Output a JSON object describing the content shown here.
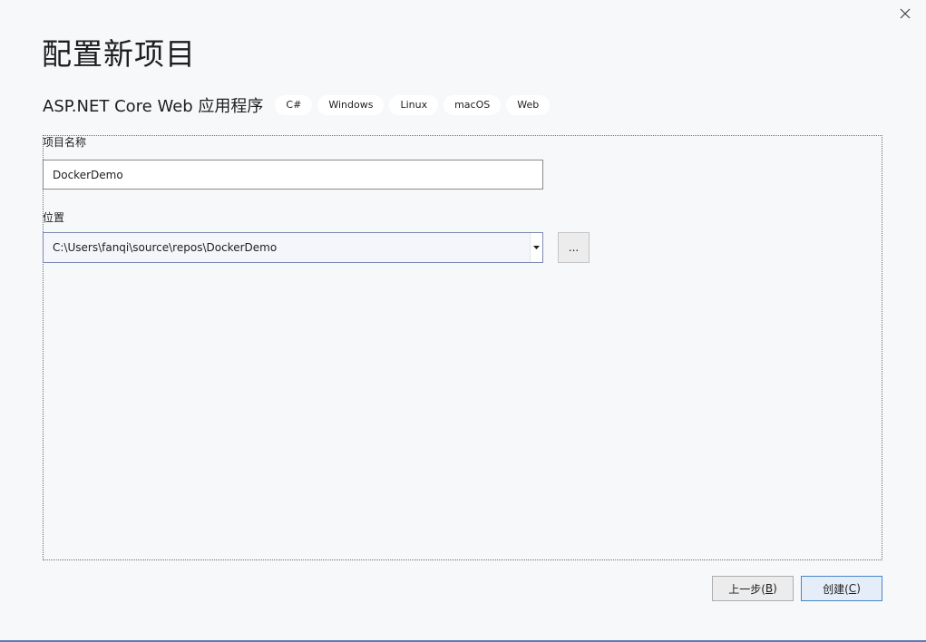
{
  "dialog": {
    "title": "配置新项目",
    "close_icon": "close-icon"
  },
  "template": {
    "name": "ASP.NET Core Web 应用程序",
    "tags": [
      "C#",
      "Windows",
      "Linux",
      "macOS",
      "Web"
    ]
  },
  "form": {
    "project_name_label": "项目名称",
    "project_name_value": "DockerDemo",
    "location_label": "位置",
    "location_value": "C:\\Users\\fanqi\\source\\repos\\DockerDemo",
    "browse_label": "..."
  },
  "buttons": {
    "back_label": "上一步(",
    "back_key": "B",
    "back_suffix": ")",
    "create_label": "创建(",
    "create_key": "C",
    "create_suffix": ")"
  },
  "colors": {
    "background": "#f7f8fa",
    "primary_border": "#4a86c7",
    "footer_accent": "#5b7bb4"
  }
}
